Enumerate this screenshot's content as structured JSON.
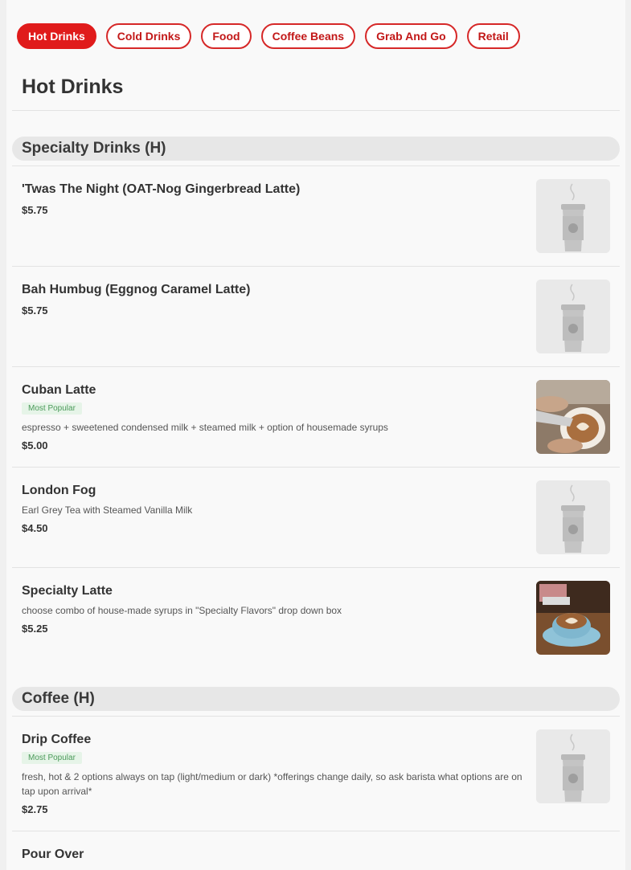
{
  "tabs": [
    "Hot Drinks",
    "Cold Drinks",
    "Food",
    "Coffee Beans",
    "Grab And Go",
    "Retail"
  ],
  "page_title": "Hot Drinks",
  "sections": [
    {
      "title": "Specialty Drinks (H)",
      "items": [
        {
          "name": "'Twas The Night (OAT-Nog Gingerbread Latte)",
          "price": "$5.75",
          "image": "cup-placeholder"
        },
        {
          "name": "Bah Humbug (Eggnog Caramel Latte)",
          "price": "$5.75",
          "image": "cup-placeholder"
        },
        {
          "name": "Cuban Latte",
          "badge": "Most Popular",
          "desc": "espresso + sweetened condensed milk + steamed milk + option of housemade syrups",
          "price": "$5.00",
          "image": "latte-pour-photo"
        },
        {
          "name": "London Fog",
          "desc": "Earl Grey Tea with Steamed Vanilla Milk",
          "price": "$4.50",
          "image": "cup-placeholder"
        },
        {
          "name": "Specialty Latte",
          "desc": "choose combo of house-made syrups in \"Specialty Flavors\" drop down box",
          "price": "$5.25",
          "image": "latte-art-photo"
        }
      ]
    },
    {
      "title": "Coffee (H)",
      "items": [
        {
          "name": "Drip Coffee",
          "badge": "Most Popular",
          "desc": "fresh, hot & 2 options always on tap (light/medium or dark) *offerings change daily, so ask barista what options are on tap upon arrival*",
          "price": "$2.75",
          "image": "cup-placeholder"
        },
        {
          "name": "Pour Over"
        }
      ]
    }
  ],
  "colors": {
    "accent": "#e01b1b",
    "badge_bg": "#e6f4e8",
    "badge_text": "#4b9a5a"
  }
}
